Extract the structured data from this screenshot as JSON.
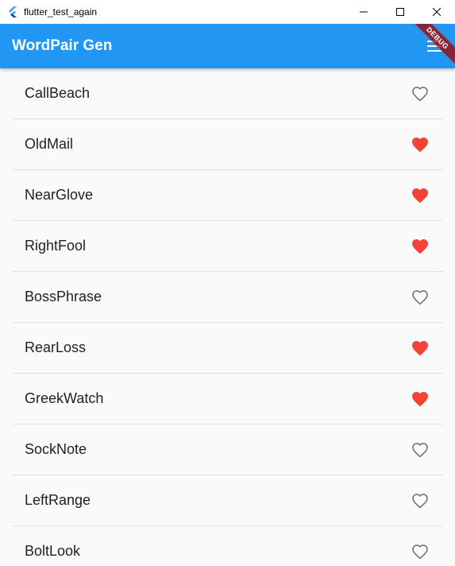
{
  "window": {
    "title": "flutter_test_again"
  },
  "appbar": {
    "title": "WordPair Gen",
    "debug_label": "DEBUG"
  },
  "colors": {
    "appbar": "#2196f3",
    "favorite": "#f44336",
    "unfavorite": "#757575"
  },
  "list": {
    "items": [
      {
        "label": "CallBeach",
        "saved": false
      },
      {
        "label": "OldMail",
        "saved": true
      },
      {
        "label": "NearGlove",
        "saved": true
      },
      {
        "label": "RightFool",
        "saved": true
      },
      {
        "label": "BossPhrase",
        "saved": false
      },
      {
        "label": "RearLoss",
        "saved": true
      },
      {
        "label": "GreekWatch",
        "saved": true
      },
      {
        "label": "SockNote",
        "saved": false
      },
      {
        "label": "LeftRange",
        "saved": false
      },
      {
        "label": "BoltLook",
        "saved": false
      }
    ]
  }
}
